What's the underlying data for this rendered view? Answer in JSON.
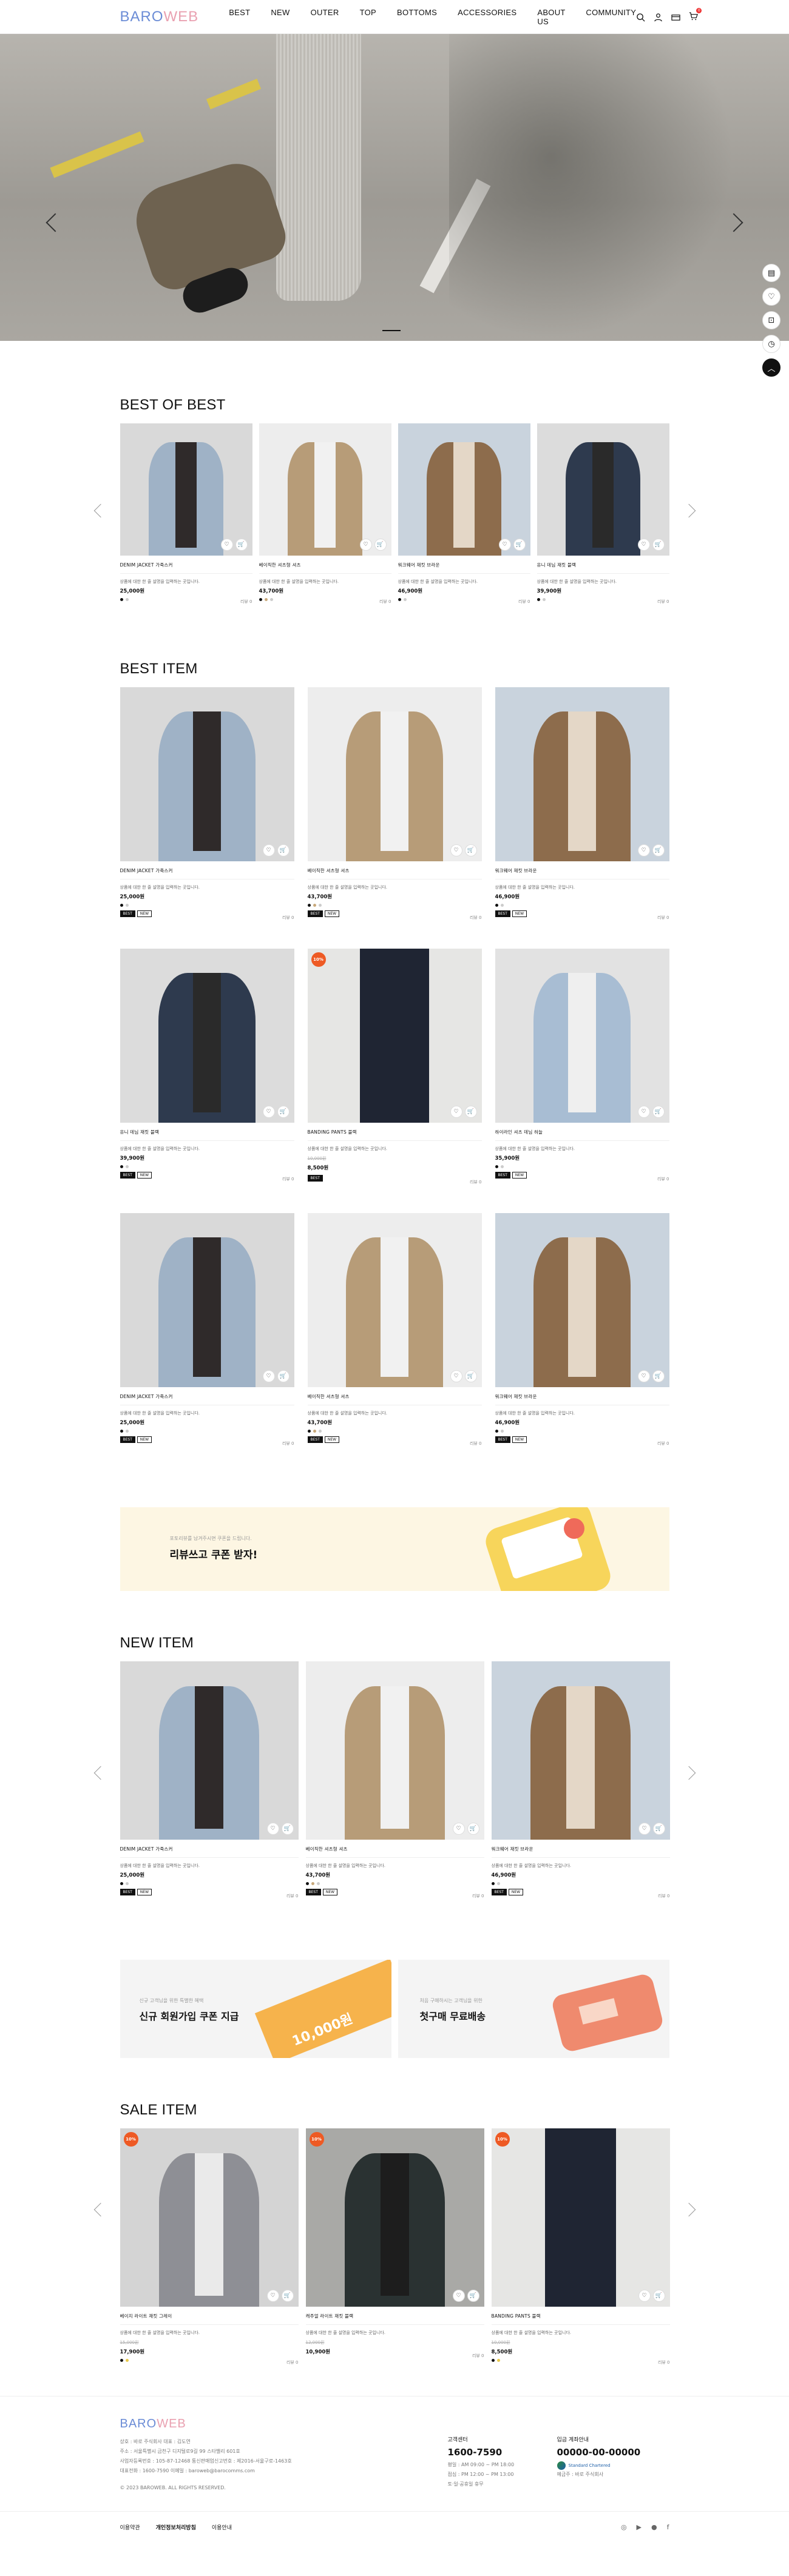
{
  "header": {
    "logo_main": "BARO",
    "logo_accent": "WEB",
    "nav": [
      "BEST",
      "NEW",
      "OUTER",
      "TOP",
      "BOTTOMS",
      "ACCESSORIES",
      "ABOUT US",
      "COMMUNITY"
    ],
    "icons": [
      "search-icon",
      "user-icon",
      "card-icon",
      "cart-icon"
    ],
    "cart_count": "0"
  },
  "quick_menu": [
    "recent-icon",
    "heart-icon",
    "lock-icon",
    "clock-icon",
    "arrow-up-icon"
  ],
  "sections": {
    "best_of_best": "BEST OF BEST",
    "best_item": "BEST ITEM",
    "new_item": "NEW ITEM",
    "sale_item": "SALE ITEM"
  },
  "products": {
    "denim": {
      "name": "DENIM JACKET 가죽스커",
      "desc": "상품에 대한 한 줄 설명을 입력하는 곳입니다.",
      "price": "25,000원",
      "review": "리뷰 0"
    },
    "beige": {
      "name": "베이직한 셔츠형 셔츠",
      "desc": "상품에 대한 한 줄 설명을 입력하는 곳입니다.",
      "price": "43,700원",
      "review": "리뷰 0"
    },
    "brown": {
      "name": "워크웨어 재킷 브라운",
      "desc": "상품에 대한 한 줄 설명을 입력하는 곳입니다.",
      "price": "46,900원",
      "review": "리뷰 0"
    },
    "navy": {
      "name": "유니 데님 재킷 블랙",
      "desc": "상품에 대한 한 줄 설명을 입력하는 곳입니다.",
      "price": "39,900원",
      "review": "리뷰 0"
    },
    "pants": {
      "name": "BANDING PANTS 블랙",
      "desc": "상품에 대한 한 줄 설명을 입력하는 곳입니다.",
      "orig": "10,000원",
      "price": "8,500원",
      "review": "리뷰 0"
    },
    "skyshirt": {
      "name": "하이라인 셔츠 데님 하늘",
      "desc": "상품에 대한 한 줄 설명을 입력하는 곳입니다.",
      "price": "35,900원",
      "review": "리뷰 0"
    },
    "grayblazer": {
      "name": "베이지 라이트 재킷 그레이",
      "desc": "상품에 대한 한 줄 설명을 입력하는 곳입니다.",
      "orig": "15,000원",
      "price": "17,900원",
      "review": "리뷰 0"
    },
    "darkjacket": {
      "name": "캐주얼 라이트 재킷 블랙",
      "desc": "상품에 대한 한 줄 설명을 입력하는 곳입니다.",
      "orig": "12,000원",
      "price": "10,900원",
      "review": "리뷰 0"
    },
    "salepants": {
      "name": "BANDING PANTS 블랙",
      "desc": "상품에 대한 한 줄 설명을 입력하는 곳입니다.",
      "orig": "10,000원",
      "price": "8,500원",
      "review": "리뷰 0"
    }
  },
  "tags": {
    "best": "BEST",
    "new": "NEW"
  },
  "sale_badge": "10%",
  "banners": {
    "review_sub": "포토리뷰를 남겨주시면 쿠폰을 드립니다.",
    "review_title": "리뷰쓰고 쿠폰 받자!",
    "signup_sub": "신규 고객님을 위한 특별한 혜택",
    "signup_title": "신규 회원가입 쿠폰 지급",
    "signup_amount": "10,000원",
    "delivery_sub": "처음 구매하시는 고객님을 위한",
    "delivery_title": "첫구매 무료배송"
  },
  "footer": {
    "logo_main": "BARO",
    "logo_accent": "WEB",
    "info": [
      "상호 : 바로 주식회사    대표 : 김도연",
      "주소 : 서울특별시 금천구 디지털로9길 99 스타밸리 601호",
      "사업자등록번호 : 105-87-12468    통신판매업신고번호 : 제2016-서울구로-1463호",
      "대표전화 : 1600-7590    이메일 : baroweb@barocomms.com"
    ],
    "copyright": "© 2023 BAROWEB. ALL RIGHTS RESERVED.",
    "cs_title": "고객센터",
    "cs_phone": "1600-7590",
    "cs_hours": [
      "평일 : AM 09:00 ~ PM 18:00",
      "점심 : PM 12:00 ~ PM 13:00",
      "토·일·공휴일 휴무"
    ],
    "bank_title": "입금 계좌안내",
    "bank_account": "00000-00-00000",
    "bank_name": "Standard Chartered",
    "bank_holder": "예금주 : 바로 주식회사",
    "links": [
      "이용약관",
      "개인정보처리방침",
      "이용안내"
    ],
    "social": [
      "instagram-icon",
      "youtube-icon",
      "blog-icon",
      "facebook-icon"
    ]
  }
}
